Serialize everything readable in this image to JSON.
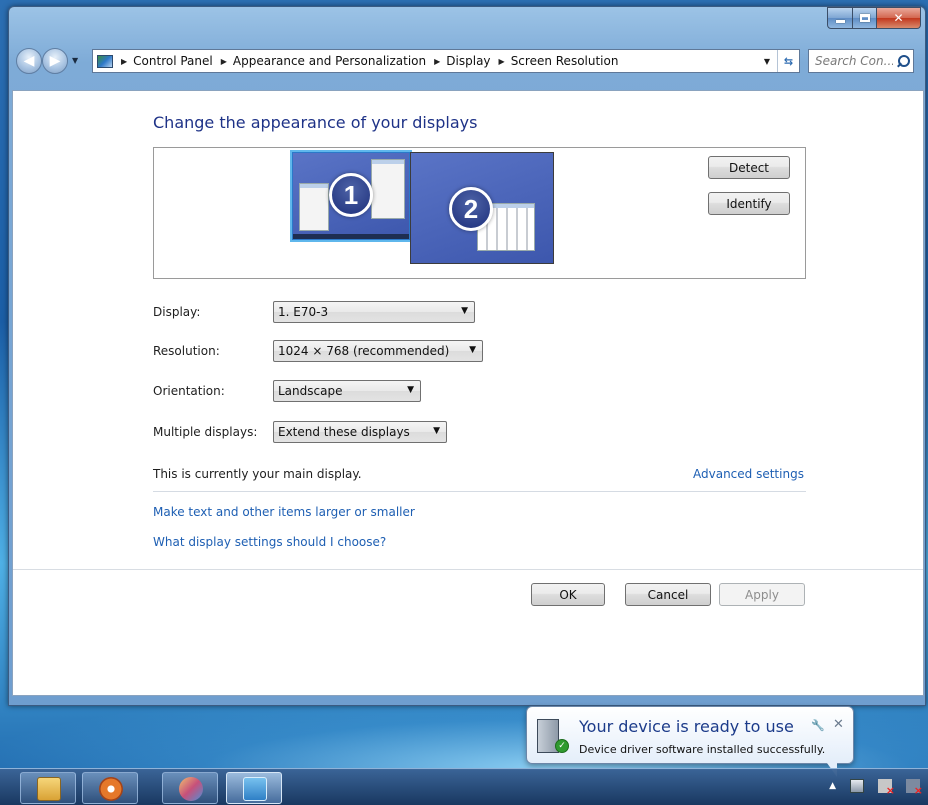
{
  "window": {
    "breadcrumbs": [
      "Control Panel",
      "Appearance and Personalization",
      "Display",
      "Screen Resolution"
    ],
    "search_placeholder": "Search Con..."
  },
  "main": {
    "title": "Change the appearance of your displays",
    "monitors": [
      "1",
      "2"
    ],
    "detect_label": "Detect",
    "identify_label": "Identify",
    "fields": {
      "display": {
        "label": "Display:",
        "value": "1. E70-3"
      },
      "resolution": {
        "label": "Resolution:",
        "value": "1024 × 768 (recommended)"
      },
      "orientation": {
        "label": "Orientation:",
        "value": "Landscape"
      },
      "multiple": {
        "label": "Multiple displays:",
        "value": "Extend these displays"
      }
    },
    "status_text": "This is currently your main display.",
    "advanced_link": "Advanced settings",
    "text_size_link": "Make text and other items larger or smaller",
    "display_choose_link": "What display settings should I choose?",
    "ok_label": "OK",
    "cancel_label": "Cancel",
    "apply_label": "Apply"
  },
  "notification": {
    "title": "Your device is ready to use",
    "message": "Device driver software installed successfully."
  },
  "taskbar": {
    "items": [
      "windows-explorer-icon",
      "media-player-icon",
      "paint-icon",
      "control-panel-icon"
    ]
  }
}
